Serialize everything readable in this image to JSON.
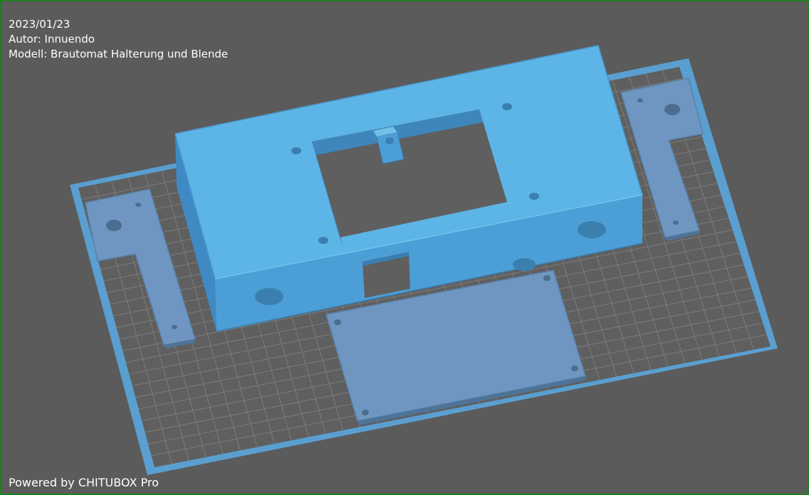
{
  "model_info": {
    "date": "2023/01/23",
    "author": "Autor: Innuendo",
    "model": "Modell: Brautomat Halterung und Blende"
  },
  "footer": {
    "powered_by": "Powered by CHITUBOX Pro"
  },
  "colors": {
    "background": "#5b5b5b",
    "plate_border": "#5a9fd0",
    "plate_fill": "#5f5f5f",
    "grid": "#7a7a7a",
    "model_top": "#5db4e6",
    "model_front": "#4c9fd6",
    "model_dark": "#3a7fb0",
    "flat_parts": "#6e96c0",
    "frame": "#1f7f1f"
  },
  "icons": [
    "build-plate",
    "housing-model",
    "bracket-left",
    "bracket-right",
    "cover-plate"
  ]
}
